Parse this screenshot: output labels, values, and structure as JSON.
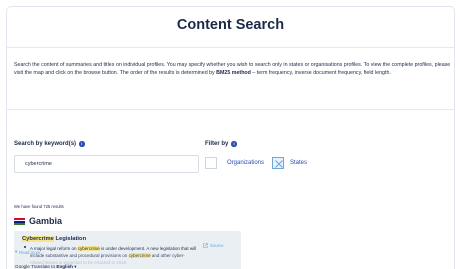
{
  "page_title": "Content Search",
  "intro": {
    "text_before": "Search the content of summaries and titles on individual profiles. You may specify whether you wish to search only in states or organisations profiles. To view the complete profiles, please visit the map and click on the browse button. The order of the results is determined by ",
    "bold": "BM25 method",
    "text_after": " – term frequency, inverse document frequency, field length."
  },
  "search": {
    "label": "Search by keyword(s)",
    "value": "cybercrime"
  },
  "filter": {
    "label": "Filter by",
    "options": [
      {
        "label": "Organizations",
        "checked": false
      },
      {
        "label": "States",
        "checked": true
      }
    ]
  },
  "results": {
    "count_text": "We have found 725 results",
    "groups": [
      {
        "country": "Gambia",
        "item": {
          "title_highlight": "Cybercrime",
          "title_rest": " Legislation",
          "line1_a": "A major legal reform on ",
          "line1_hl": "cybercrime",
          "line1_b": " is under development. A new legislation that will",
          "line2_a": "include substantive and procedural provisions on ",
          "line2_hl": "cybercrime",
          "line2_b": " and other cyber-",
          "line3": "related issues is expected to be enacted in 2018",
          "source_label": "Source",
          "read_more_label": "Read more"
        }
      }
    ]
  },
  "translate": {
    "label": "Google Translate to",
    "language": "English"
  },
  "colors": {
    "navy": "#1c2a4a",
    "accent_blue": "#2b4eb0",
    "link_blue": "#6fa7dc",
    "card_bg": "#e9eff3",
    "highlight": "#f6e58a"
  }
}
